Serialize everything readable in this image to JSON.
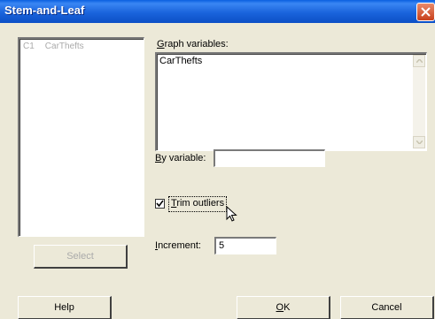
{
  "window": {
    "title": "Stem-and-Leaf"
  },
  "variable_list": {
    "items": [
      {
        "column": "C1",
        "name": "CarThefts"
      }
    ]
  },
  "graph_variables": {
    "label_prefix": "G",
    "label_rest": "raph variables:",
    "value": "CarThefts"
  },
  "by_variable": {
    "label_prefix": "B",
    "label_rest": "y variable:",
    "value": ""
  },
  "trim_outliers": {
    "label_prefix": "T",
    "label_rest": "rim outliers",
    "checked": true
  },
  "increment": {
    "label_prefix": "I",
    "label_rest": "ncrement:",
    "value": "5"
  },
  "buttons": {
    "select": "Select",
    "help": "Help",
    "ok_prefix": "O",
    "ok_rest": "K",
    "cancel": "Cancel"
  },
  "colors": {
    "titlebar": "#1a64dc",
    "background": "#ece9d8"
  },
  "icons": {
    "close": "close-icon",
    "cursor": "mouse-pointer-icon",
    "scroll_up": "chevron-up-icon",
    "scroll_down": "chevron-down-icon",
    "check": "checkmark-icon"
  }
}
